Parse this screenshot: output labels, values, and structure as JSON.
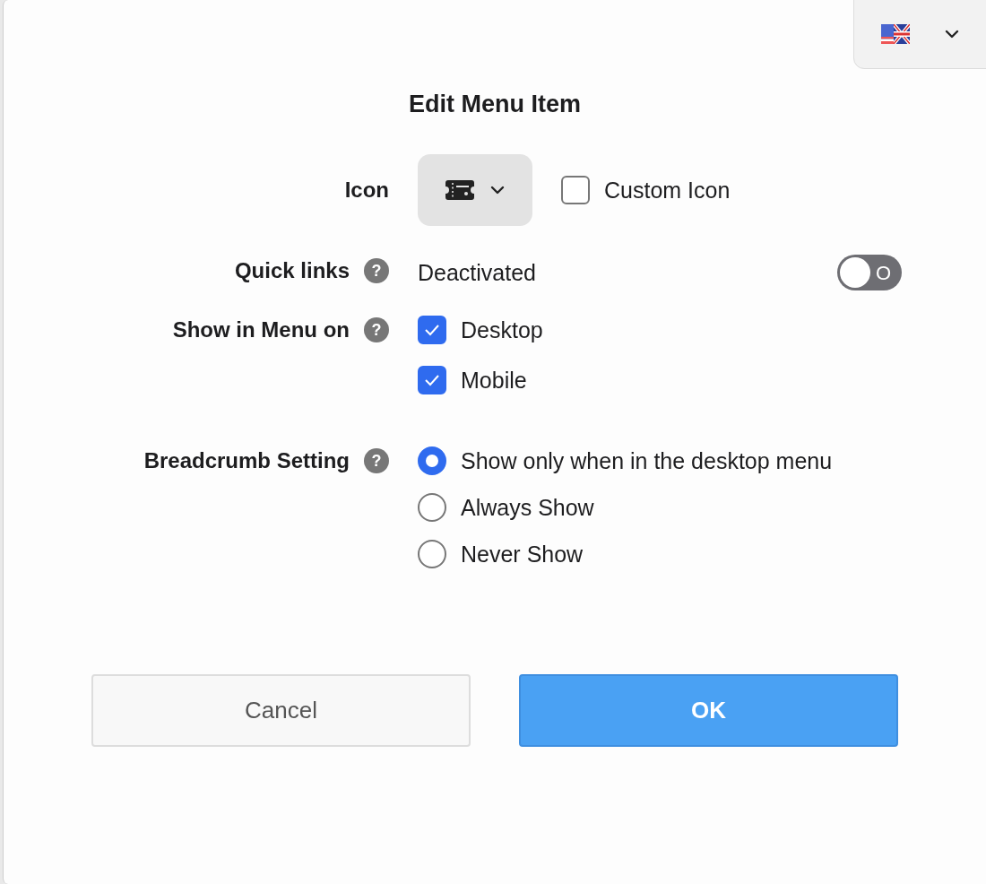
{
  "language_selector": {
    "kind": "flag"
  },
  "dialog": {
    "title": "Edit Menu Item"
  },
  "icon_row": {
    "label": "Icon",
    "custom_icon": {
      "label": "Custom Icon",
      "checked": false
    }
  },
  "quick_links": {
    "label": "Quick links",
    "help": "?",
    "status": "Deactivated",
    "on": false,
    "toggle_text": "O"
  },
  "show_in_menu": {
    "label": "Show in Menu on",
    "help": "?",
    "options": [
      {
        "label": "Desktop",
        "checked": true
      },
      {
        "label": "Mobile",
        "checked": true
      }
    ]
  },
  "breadcrumb": {
    "label": "Breadcrumb Setting",
    "help": "?",
    "options": [
      {
        "label": "Show only when in the desktop menu",
        "selected": true
      },
      {
        "label": "Always Show",
        "selected": false
      },
      {
        "label": "Never Show",
        "selected": false
      }
    ]
  },
  "buttons": [
    {
      "label": "Cancel",
      "kind": "secondary"
    },
    {
      "label": "OK",
      "kind": "primary"
    }
  ]
}
